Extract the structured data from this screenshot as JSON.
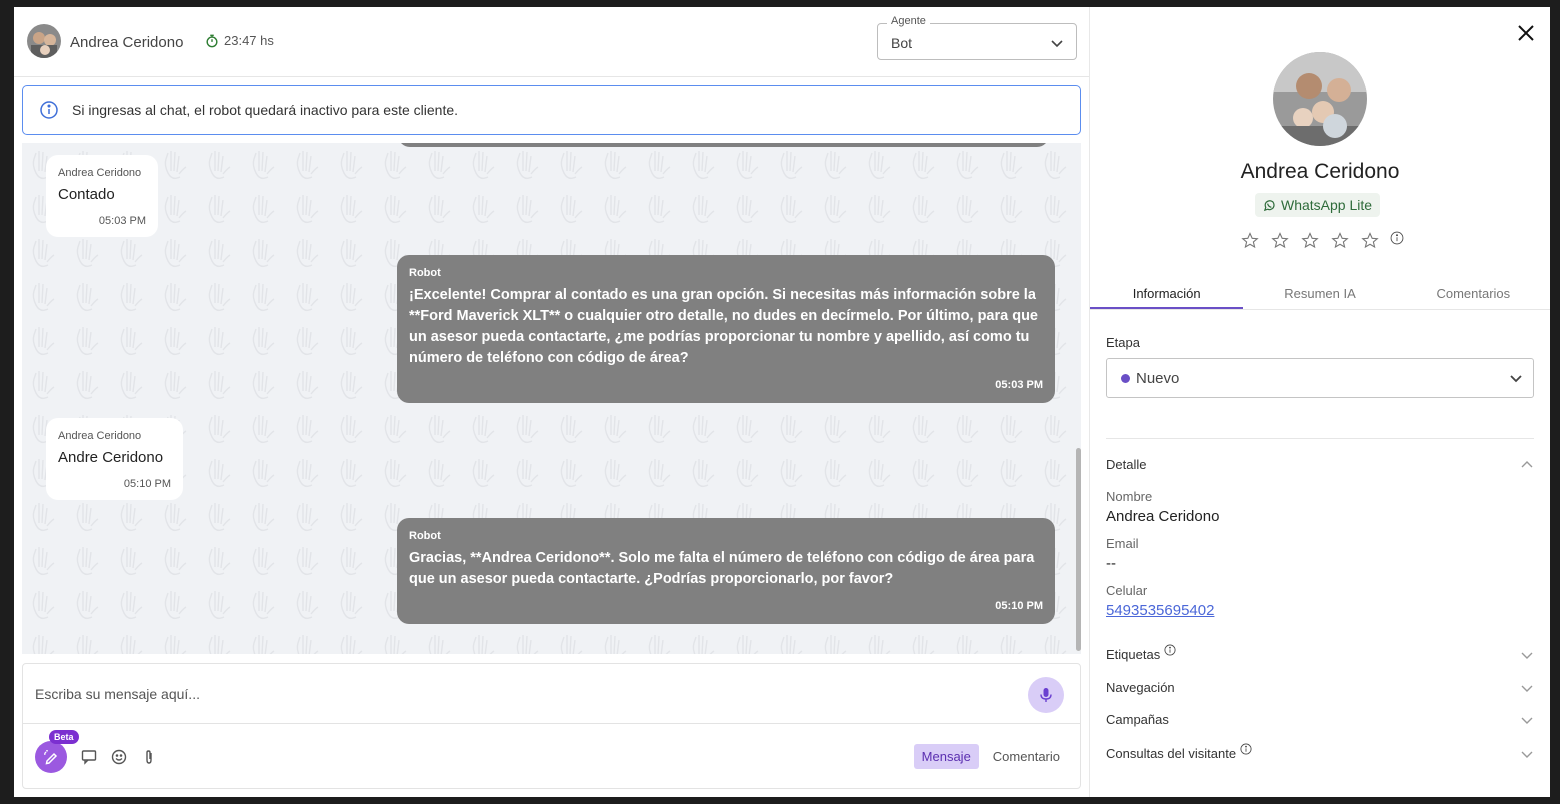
{
  "header": {
    "contact_name": "Andrea Ceridono",
    "timer": "23:47 hs",
    "agent_label": "Agente",
    "agent_value": "Bot"
  },
  "banner": {
    "text": "Si ingresas al chat, el robot quedará inactivo para este cliente."
  },
  "messages": [
    {
      "direction": "in",
      "sender": "Andrea Ceridono",
      "text": "Contado",
      "time": "05:03 PM"
    },
    {
      "direction": "out",
      "sender": "Robot",
      "text": "¡Excelente! Comprar al contado es una gran opción. Si necesitas más información sobre la **Ford Maverick XLT** o cualquier otro detalle, no dudes en decírmelo. Por último, para que un asesor pueda contactarte, ¿me podrías proporcionar tu nombre y apellido, así como tu número de teléfono con código de área?",
      "time": "05:03 PM"
    },
    {
      "direction": "in",
      "sender": "Andrea Ceridono",
      "text": "Andre Ceridono",
      "time": "05:10 PM"
    },
    {
      "direction": "out",
      "sender": "Robot",
      "text": "Gracias, **Andrea Ceridono**. Solo me falta el número de teléfono con código de área para que un asesor pueda contactarte. ¿Podrías proporcionarlo, por favor?",
      "time": "05:10 PM"
    }
  ],
  "composer": {
    "placeholder": "Escriba su mensaje aquí...",
    "beta_badge": "Beta",
    "tab_message": "Mensaje",
    "tab_comment": "Comentario"
  },
  "profile": {
    "name": "Andrea Ceridono",
    "channel": "WhatsApp Lite",
    "rating": 0,
    "tabs": [
      "Información",
      "Resumen IA",
      "Comentarios"
    ],
    "active_tab": "Información",
    "stage_label": "Etapa",
    "stage_value": "Nuevo",
    "stage_color": "#6a4fc6",
    "detail_label": "Detalle",
    "fields": {
      "name_label": "Nombre",
      "name_value": "Andrea Ceridono",
      "email_label": "Email",
      "email_value": "--",
      "phone_label": "Celular",
      "phone_value": "5493535695402"
    },
    "sections": [
      "Etiquetas",
      "Navegación",
      "Campañas",
      "Consultas del visitante"
    ]
  }
}
